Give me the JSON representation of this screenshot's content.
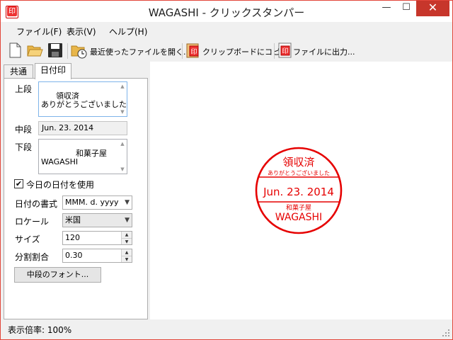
{
  "window": {
    "title": "WAGASHI - クリックスタンパー",
    "minimize": "—",
    "maximize": "☐",
    "close": "✕"
  },
  "menu": [
    "ファイル(F)",
    "表示(V)",
    "ヘルプ(H)"
  ],
  "toolbar": {
    "new_icon": "new-file-icon",
    "open_icon": "open-folder-icon",
    "save_icon": "save-icon",
    "recent_label": "最近使ったファイルを開く...",
    "clipboard_label": "クリップボードにコピー",
    "export_label": "ファイルに出力..."
  },
  "tabs": [
    "共通",
    "日付印"
  ],
  "form": {
    "top_label": "上段",
    "top_value": "領収済\nありがとうございました",
    "middle_label": "中段",
    "middle_value": "Jun. 23. 2014",
    "bottom_label": "下段",
    "bottom_value": "        和菓子屋\nWAGASHI",
    "today_checkbox_label": "今日の日付を使用",
    "today_checked": true,
    "date_format_label": "日付の書式",
    "date_format_value": "MMM. d. yyyy",
    "locale_label": "ロケール",
    "locale_value": "米国",
    "size_label": "サイズ",
    "size_value": "120",
    "split_label": "分割割合",
    "split_value": "0.30",
    "font_button": "中段のフォント..."
  },
  "stamp": {
    "top_main": "領収済",
    "top_sub": "ありがとうございました",
    "middle": "Jun. 23. 2014",
    "bottom_sub": "和菓子屋",
    "bottom_main": "WAGASHI",
    "color": "#e60000"
  },
  "status": {
    "zoom_text": "表示倍率: 100%"
  },
  "colors": {
    "accent": "#c7362b"
  }
}
